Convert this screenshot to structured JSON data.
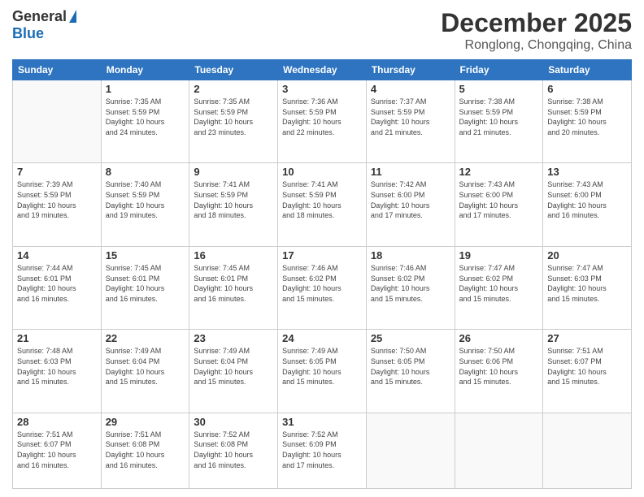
{
  "logo": {
    "general": "General",
    "blue": "Blue"
  },
  "title": {
    "month": "December 2025",
    "location": "Ronglong, Chongqing, China"
  },
  "headers": [
    "Sunday",
    "Monday",
    "Tuesday",
    "Wednesday",
    "Thursday",
    "Friday",
    "Saturday"
  ],
  "weeks": [
    [
      {
        "day": "",
        "info": ""
      },
      {
        "day": "1",
        "info": "Sunrise: 7:35 AM\nSunset: 5:59 PM\nDaylight: 10 hours\nand 24 minutes."
      },
      {
        "day": "2",
        "info": "Sunrise: 7:35 AM\nSunset: 5:59 PM\nDaylight: 10 hours\nand 23 minutes."
      },
      {
        "day": "3",
        "info": "Sunrise: 7:36 AM\nSunset: 5:59 PM\nDaylight: 10 hours\nand 22 minutes."
      },
      {
        "day": "4",
        "info": "Sunrise: 7:37 AM\nSunset: 5:59 PM\nDaylight: 10 hours\nand 21 minutes."
      },
      {
        "day": "5",
        "info": "Sunrise: 7:38 AM\nSunset: 5:59 PM\nDaylight: 10 hours\nand 21 minutes."
      },
      {
        "day": "6",
        "info": "Sunrise: 7:38 AM\nSunset: 5:59 PM\nDaylight: 10 hours\nand 20 minutes."
      }
    ],
    [
      {
        "day": "7",
        "info": "Sunrise: 7:39 AM\nSunset: 5:59 PM\nDaylight: 10 hours\nand 19 minutes."
      },
      {
        "day": "8",
        "info": "Sunrise: 7:40 AM\nSunset: 5:59 PM\nDaylight: 10 hours\nand 19 minutes."
      },
      {
        "day": "9",
        "info": "Sunrise: 7:41 AM\nSunset: 5:59 PM\nDaylight: 10 hours\nand 18 minutes."
      },
      {
        "day": "10",
        "info": "Sunrise: 7:41 AM\nSunset: 5:59 PM\nDaylight: 10 hours\nand 18 minutes."
      },
      {
        "day": "11",
        "info": "Sunrise: 7:42 AM\nSunset: 6:00 PM\nDaylight: 10 hours\nand 17 minutes."
      },
      {
        "day": "12",
        "info": "Sunrise: 7:43 AM\nSunset: 6:00 PM\nDaylight: 10 hours\nand 17 minutes."
      },
      {
        "day": "13",
        "info": "Sunrise: 7:43 AM\nSunset: 6:00 PM\nDaylight: 10 hours\nand 16 minutes."
      }
    ],
    [
      {
        "day": "14",
        "info": "Sunrise: 7:44 AM\nSunset: 6:01 PM\nDaylight: 10 hours\nand 16 minutes."
      },
      {
        "day": "15",
        "info": "Sunrise: 7:45 AM\nSunset: 6:01 PM\nDaylight: 10 hours\nand 16 minutes."
      },
      {
        "day": "16",
        "info": "Sunrise: 7:45 AM\nSunset: 6:01 PM\nDaylight: 10 hours\nand 16 minutes."
      },
      {
        "day": "17",
        "info": "Sunrise: 7:46 AM\nSunset: 6:02 PM\nDaylight: 10 hours\nand 15 minutes."
      },
      {
        "day": "18",
        "info": "Sunrise: 7:46 AM\nSunset: 6:02 PM\nDaylight: 10 hours\nand 15 minutes."
      },
      {
        "day": "19",
        "info": "Sunrise: 7:47 AM\nSunset: 6:02 PM\nDaylight: 10 hours\nand 15 minutes."
      },
      {
        "day": "20",
        "info": "Sunrise: 7:47 AM\nSunset: 6:03 PM\nDaylight: 10 hours\nand 15 minutes."
      }
    ],
    [
      {
        "day": "21",
        "info": "Sunrise: 7:48 AM\nSunset: 6:03 PM\nDaylight: 10 hours\nand 15 minutes."
      },
      {
        "day": "22",
        "info": "Sunrise: 7:49 AM\nSunset: 6:04 PM\nDaylight: 10 hours\nand 15 minutes."
      },
      {
        "day": "23",
        "info": "Sunrise: 7:49 AM\nSunset: 6:04 PM\nDaylight: 10 hours\nand 15 minutes."
      },
      {
        "day": "24",
        "info": "Sunrise: 7:49 AM\nSunset: 6:05 PM\nDaylight: 10 hours\nand 15 minutes."
      },
      {
        "day": "25",
        "info": "Sunrise: 7:50 AM\nSunset: 6:05 PM\nDaylight: 10 hours\nand 15 minutes."
      },
      {
        "day": "26",
        "info": "Sunrise: 7:50 AM\nSunset: 6:06 PM\nDaylight: 10 hours\nand 15 minutes."
      },
      {
        "day": "27",
        "info": "Sunrise: 7:51 AM\nSunset: 6:07 PM\nDaylight: 10 hours\nand 15 minutes."
      }
    ],
    [
      {
        "day": "28",
        "info": "Sunrise: 7:51 AM\nSunset: 6:07 PM\nDaylight: 10 hours\nand 16 minutes."
      },
      {
        "day": "29",
        "info": "Sunrise: 7:51 AM\nSunset: 6:08 PM\nDaylight: 10 hours\nand 16 minutes."
      },
      {
        "day": "30",
        "info": "Sunrise: 7:52 AM\nSunset: 6:08 PM\nDaylight: 10 hours\nand 16 minutes."
      },
      {
        "day": "31",
        "info": "Sunrise: 7:52 AM\nSunset: 6:09 PM\nDaylight: 10 hours\nand 17 minutes."
      },
      {
        "day": "",
        "info": ""
      },
      {
        "day": "",
        "info": ""
      },
      {
        "day": "",
        "info": ""
      }
    ]
  ]
}
